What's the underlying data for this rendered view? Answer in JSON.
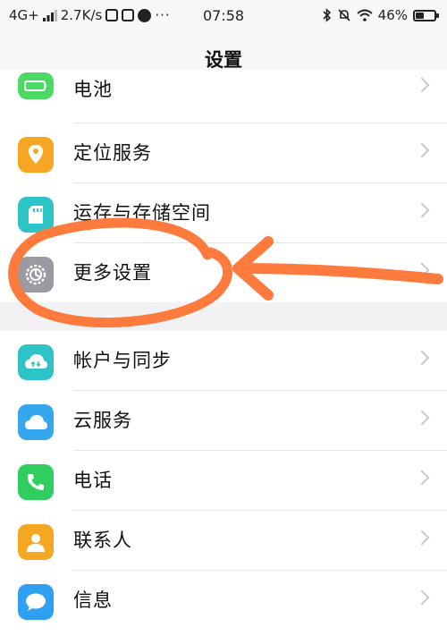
{
  "status_bar": {
    "network": "4G+",
    "speed": "2.7K/s",
    "time": "07:58",
    "battery_percent": "46%",
    "battery_level": 0.46
  },
  "header": {
    "title": "设置"
  },
  "settings": {
    "group1": [
      {
        "label": "电池",
        "icon": "battery-icon",
        "color": "#4cd964"
      },
      {
        "label": "定位服务",
        "icon": "location-icon",
        "color": "#f6a623"
      },
      {
        "label": "运存与存储空间",
        "icon": "storage-card-icon",
        "color": "#2ec4c7"
      },
      {
        "label": "更多设置",
        "icon": "gear-icon",
        "color": "#9a9aa0"
      }
    ],
    "group2": [
      {
        "label": "帐户与同步",
        "icon": "account-sync-icon",
        "color": "#2ec4c7"
      },
      {
        "label": "云服务",
        "icon": "cloud-icon",
        "color": "#35a7ee"
      },
      {
        "label": "电话",
        "icon": "phone-icon",
        "color": "#2fce5e"
      },
      {
        "label": "联系人",
        "icon": "contacts-icon",
        "color": "#f5a623"
      },
      {
        "label": "信息",
        "icon": "message-icon",
        "color": "#2f9ff2"
      }
    ]
  },
  "annotation": {
    "color": "#ff7a3d"
  }
}
